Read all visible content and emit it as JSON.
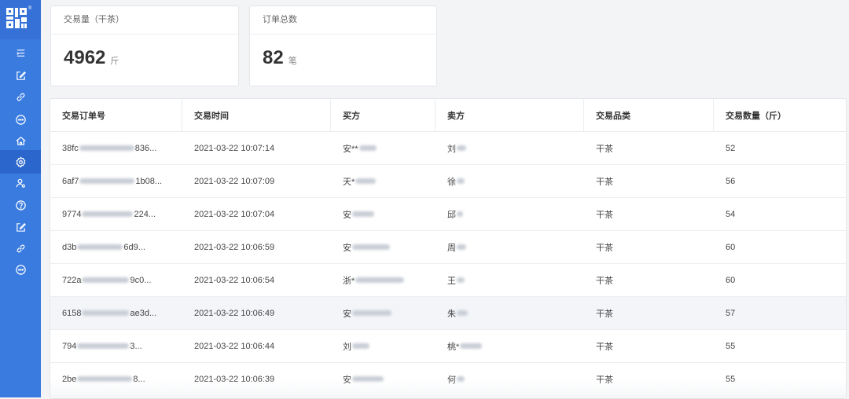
{
  "sidebar": {
    "colors": {
      "bg": "#3a7be0",
      "active": "#2b66cc",
      "icon": "#ffffff"
    },
    "items": [
      {
        "icon": "menu-fold-icon"
      },
      {
        "icon": "edit-icon"
      },
      {
        "icon": "link-icon"
      },
      {
        "icon": "message-icon"
      },
      {
        "icon": "home-icon"
      },
      {
        "icon": "gear-icon",
        "active": true
      },
      {
        "icon": "user-settings-icon"
      },
      {
        "icon": "help-icon"
      },
      {
        "icon": "edit-icon"
      },
      {
        "icon": "link-icon"
      },
      {
        "icon": "message-icon"
      }
    ]
  },
  "stats": [
    {
      "title": "交易量（干茶）",
      "value": "4962",
      "unit": "斤"
    },
    {
      "title": "订单总数",
      "value": "82",
      "unit": "笔"
    }
  ],
  "table": {
    "columns": [
      "交易订单号",
      "交易时间",
      "买方",
      "卖方",
      "交易品类",
      "交易数量（斤）"
    ],
    "rows": [
      {
        "id_prefix": "38fc",
        "id_suffix": "836...",
        "time": "2021-03-22 10:07:14",
        "buyer": "安**",
        "seller": "刘",
        "category": "干茶",
        "qty": "52"
      },
      {
        "id_prefix": "6af7",
        "id_suffix": "1b08...",
        "time": "2021-03-22 10:07:09",
        "buyer": "天*",
        "seller": "徐",
        "category": "干茶",
        "qty": "56"
      },
      {
        "id_prefix": "9774",
        "id_suffix": "224...",
        "time": "2021-03-22 10:07:04",
        "buyer": "安",
        "seller": "邱",
        "category": "干茶",
        "qty": "54"
      },
      {
        "id_prefix": "d3b",
        "id_suffix": "6d9...",
        "time": "2021-03-22 10:06:59",
        "buyer": "安",
        "seller": "周",
        "category": "干茶",
        "qty": "60"
      },
      {
        "id_prefix": "722a",
        "id_suffix": "9c0...",
        "time": "2021-03-22 10:06:54",
        "buyer": "浙*",
        "seller": "王",
        "category": "干茶",
        "qty": "60"
      },
      {
        "id_prefix": "6158",
        "id_suffix": "ae3d...",
        "time": "2021-03-22 10:06:49",
        "buyer": "安",
        "seller": "朱",
        "category": "干茶",
        "qty": "57",
        "highlight": true
      },
      {
        "id_prefix": "794",
        "id_suffix": "3...",
        "time": "2021-03-22 10:06:44",
        "buyer": "刘",
        "seller": "桃*",
        "category": "干茶",
        "qty": "55"
      },
      {
        "id_prefix": "2be",
        "id_suffix": "8...",
        "time": "2021-03-22 10:06:39",
        "buyer": "安",
        "seller": "何",
        "category": "干茶",
        "qty": "55"
      }
    ]
  }
}
